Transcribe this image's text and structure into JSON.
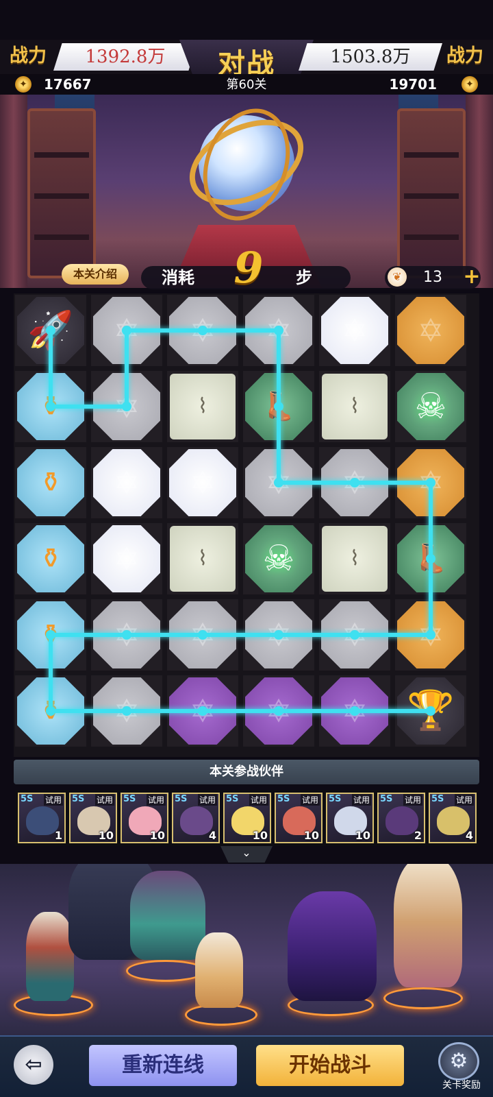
{
  "top": {
    "left_label": "战力",
    "left_power": "1392.8万",
    "title": "对战",
    "right_power": "1503.8万",
    "right_label": "战力",
    "left_coins": "17667",
    "stage": "第60关",
    "right_coins": "19701"
  },
  "info": {
    "intro_button": "本关介绍",
    "steps_prefix": "消耗",
    "steps_value": "9",
    "steps_suffix": "步",
    "energy": "13",
    "plus": "+"
  },
  "board": {
    "rows": 6,
    "cols": 6,
    "tiles": [
      [
        "rocket",
        "gray",
        "gray",
        "gray",
        "white",
        "orange"
      ],
      [
        "cage",
        "gray",
        "stone",
        "boot",
        "stone",
        "skull"
      ],
      [
        "cage",
        "white",
        "white",
        "gray",
        "gray",
        "orange"
      ],
      [
        "cage",
        "white",
        "stone",
        "skull",
        "stone",
        "boot"
      ],
      [
        "cage",
        "gray",
        "gray",
        "gray",
        "gray",
        "orange"
      ],
      [
        "cage",
        "gray",
        "purple",
        "purple",
        "purple",
        "cup"
      ]
    ],
    "path": [
      [
        0,
        0
      ],
      [
        1,
        0
      ],
      [
        1,
        1
      ],
      [
        0,
        1
      ],
      [
        0,
        2
      ],
      [
        0,
        3
      ],
      [
        1,
        3
      ],
      [
        2,
        3
      ],
      [
        2,
        4
      ],
      [
        2,
        5
      ],
      [
        3,
        5
      ],
      [
        4,
        5
      ],
      [
        4,
        4
      ],
      [
        4,
        3
      ],
      [
        4,
        2
      ],
      [
        4,
        1
      ],
      [
        4,
        0
      ],
      [
        5,
        0
      ],
      [
        5,
        1
      ],
      [
        5,
        2
      ],
      [
        5,
        3
      ],
      [
        5,
        4
      ],
      [
        5,
        5
      ]
    ],
    "path_color": "#3fe0f0"
  },
  "partners": {
    "title": "本关参战伙伴",
    "cards": [
      {
        "grade": "5S",
        "tag": "试用",
        "level": "1",
        "color": "#3c4e78"
      },
      {
        "grade": "5S",
        "tag": "试用",
        "level": "10",
        "color": "#d8c8b0"
      },
      {
        "grade": "5S",
        "tag": "试用",
        "level": "10",
        "color": "#f0a8b8"
      },
      {
        "grade": "5S",
        "tag": "试用",
        "level": "4",
        "color": "#6a4a8a"
      },
      {
        "grade": "5S",
        "tag": "试用",
        "level": "10",
        "color": "#f2d66a"
      },
      {
        "grade": "5S",
        "tag": "试用",
        "level": "10",
        "color": "#d86a5a"
      },
      {
        "grade": "5S",
        "tag": "试用",
        "level": "10",
        "color": "#d0d8ea"
      },
      {
        "grade": "5S",
        "tag": "试用",
        "level": "2",
        "color": "#5a3a7a"
      },
      {
        "grade": "5S",
        "tag": "试用",
        "level": "4",
        "color": "#d8c06a"
      }
    ],
    "collapse_icon": "chevron-down-icon"
  },
  "bottom": {
    "back_icon": "exit-icon",
    "relink_button": "重新连线",
    "start_button": "开始战斗",
    "reward_label": "关卡奖励"
  },
  "colors": {
    "gold": "#f4c030",
    "path": "#3fe0f0",
    "power_red": "#c43a3a"
  }
}
